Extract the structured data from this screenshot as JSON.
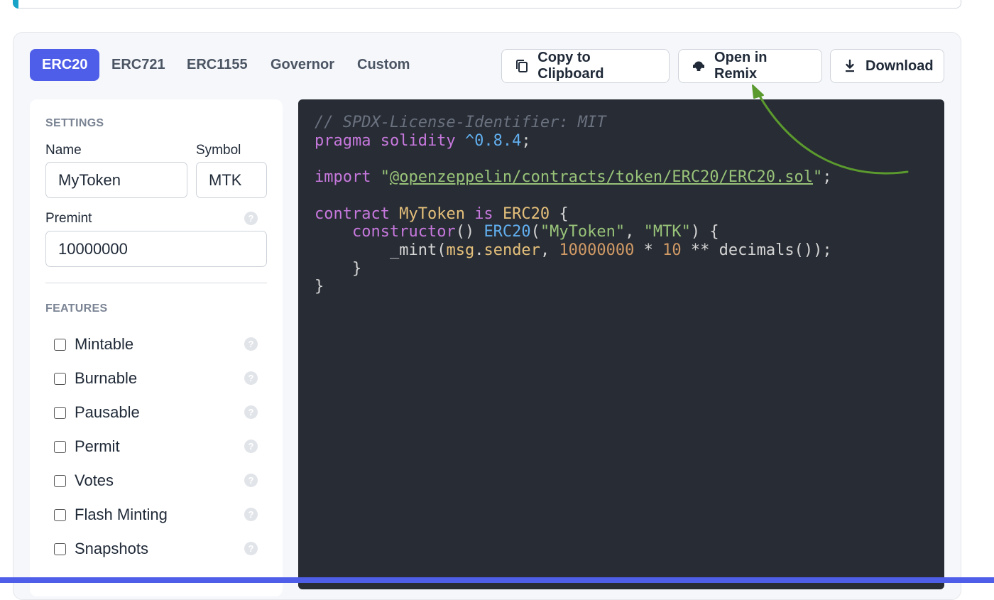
{
  "tabs": [
    {
      "label": "ERC20",
      "active": true
    },
    {
      "label": "ERC721",
      "active": false
    },
    {
      "label": "ERC1155",
      "active": false
    },
    {
      "label": "Governor",
      "active": false
    },
    {
      "label": "Custom",
      "active": false
    }
  ],
  "actions": {
    "copy": {
      "label": "Copy to Clipboard",
      "icon": "copy-icon"
    },
    "remix": {
      "label": "Open in Remix",
      "icon": "remix-icon"
    },
    "download": {
      "label": "Download",
      "icon": "download-icon"
    }
  },
  "settings": {
    "title": "SETTINGS",
    "name_label": "Name",
    "name_value": "MyToken",
    "symbol_label": "Symbol",
    "symbol_value": "MTK",
    "premint_label": "Premint",
    "premint_value": "10000000"
  },
  "features": {
    "title": "FEATURES",
    "items": [
      {
        "label": "Mintable",
        "checked": false
      },
      {
        "label": "Burnable",
        "checked": false
      },
      {
        "label": "Pausable",
        "checked": false
      },
      {
        "label": "Permit",
        "checked": false
      },
      {
        "label": "Votes",
        "checked": false
      },
      {
        "label": "Flash Minting",
        "checked": false
      },
      {
        "label": "Snapshots",
        "checked": false
      }
    ]
  },
  "code": {
    "license": "// SPDX-License-Identifier: MIT",
    "pragma_kw": "pragma solidity",
    "pragma_ver": "^0.8.4",
    "import_kw": "import",
    "import_path": "@openzeppelin/contracts/token/ERC20/ERC20.sol",
    "contract_kw": "contract",
    "contract_name": "MyToken",
    "is_kw": "is",
    "base": "ERC20",
    "ctor_kw": "constructor",
    "ctor_base": "ERC20",
    "ctor_arg1": "\"MyToken\"",
    "ctor_arg2": "\"MTK\"",
    "mint_fn": "_mint",
    "msg": "msg",
    "sender": "sender",
    "amount": "10000000",
    "ten": "10",
    "decimals": "decimals"
  },
  "colors": {
    "accent": "#4f5ee8",
    "code_bg": "#282c34",
    "arrow": "#5b9a2e"
  }
}
